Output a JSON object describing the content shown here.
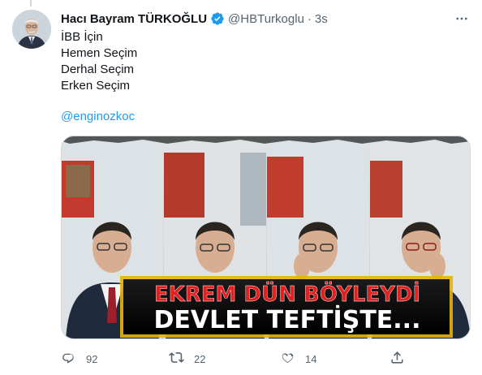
{
  "tweet": {
    "author": {
      "name": "Hacı Bayram TÜRKOĞLU",
      "handle": "@HBTurkoglu",
      "separator": "·",
      "time": "3s"
    },
    "lines": [
      "İBB İçin",
      "Hemen Seçim",
      "Derhal Seçim",
      "Erken Seçim"
    ],
    "mention": "@enginozkoc",
    "image": {
      "banner_top": "EKREM DÜN BÖYLEYDİ",
      "banner_bottom": "DEVLET TEFTİŞTE..."
    },
    "actions": {
      "reply_count": "92",
      "retweet_count": "22",
      "like_count": "14"
    }
  },
  "icons": {
    "verified": "verified-badge-icon",
    "more": "more-icon",
    "reply": "reply-icon",
    "retweet": "retweet-icon",
    "like": "heart-icon",
    "share": "share-icon"
  },
  "colors": {
    "accent": "#1d9bf0",
    "secondary_text": "#536471",
    "banner_red": "#e01d1d",
    "banner_gold": "#f2b705"
  }
}
